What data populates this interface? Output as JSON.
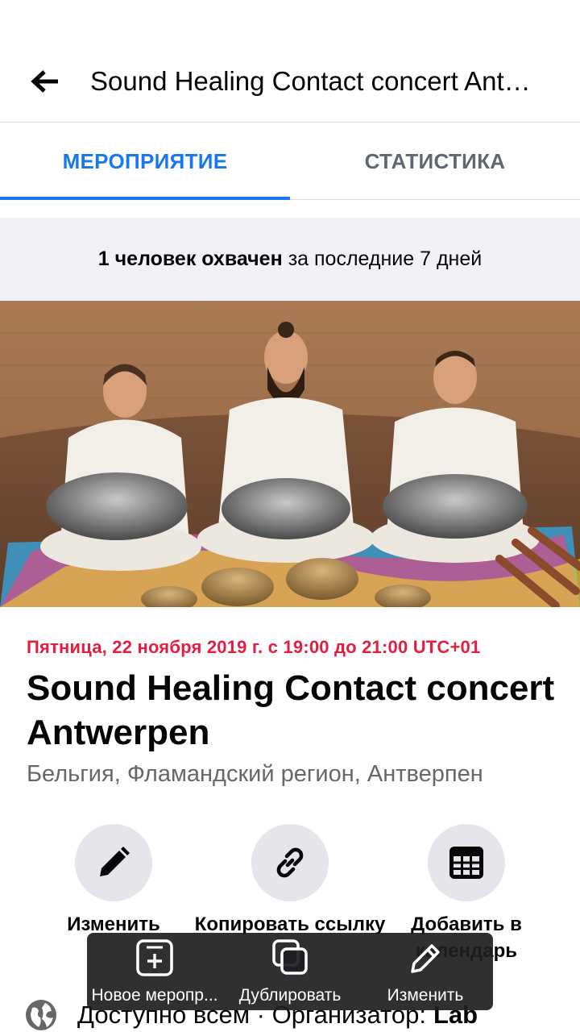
{
  "header": {
    "title": "Sound Healing Contact concert Antwerpen",
    "back_icon": "arrow-left-icon"
  },
  "tabs": [
    {
      "label": "МЕРОПРИЯТИЕ",
      "active": true
    },
    {
      "label": "СТАТИСТИКА",
      "active": false
    }
  ],
  "reach": {
    "bold": "1 человек охвачен",
    "rest": "за последние 7 дней"
  },
  "event": {
    "date": "Пятница, 22 ноября 2019 г. с 19:00 до 21:00 UTC+01",
    "name": "Sound Healing Contact concert Antwerpen",
    "location": "Бельгия, Фламандский регион, Антверпен"
  },
  "actions": [
    {
      "label": "Изменить",
      "icon": "pencil-icon"
    },
    {
      "label": "Копировать ссылку",
      "icon": "link-icon"
    },
    {
      "label": "Добавить в календарь",
      "icon": "calendar-icon"
    }
  ],
  "privacy": {
    "icon": "globe-icon",
    "text": "Доступно всем · Организатор:",
    "organizer": "Lab"
  },
  "overlay": [
    {
      "label": "Новое меропр...",
      "icon": "new-event-icon"
    },
    {
      "label": "Дублировать",
      "icon": "duplicate-icon"
    },
    {
      "label": "Изменить",
      "icon": "pencil-icon"
    }
  ],
  "colors": {
    "accent": "#1877f2",
    "date_red": "#e41e3f",
    "muted_text": "#65676b",
    "button_bg": "#e4e6eb",
    "reach_bg": "#f0f2f5"
  }
}
